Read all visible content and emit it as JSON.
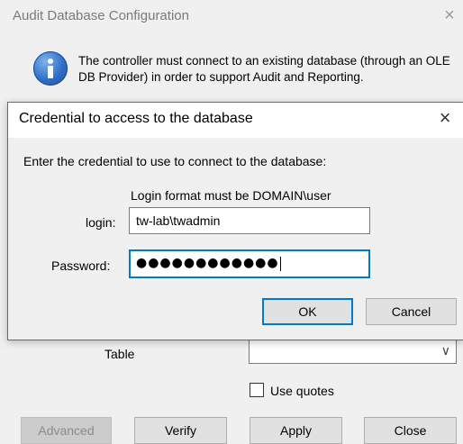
{
  "outer": {
    "title": "Audit Database Configuration",
    "close_glyph": "×",
    "info_icon": "info-icon",
    "info_text": "The controller must connect to an existing database (through an OLE DB Provider) in order to support Audit and Reporting.",
    "table_label": "Table",
    "table_value": "",
    "table_chevron": "∨",
    "use_quotes_label": "Use quotes",
    "use_quotes_checked": false,
    "buttons": {
      "advanced": "Advanced",
      "verify": "Verify",
      "apply": "Apply",
      "close": "Close"
    }
  },
  "dialog": {
    "title": "Credential to access to the database",
    "close_glyph": "×",
    "instruction": "Enter the credential to use to connect to the database:",
    "format_note": "Login format must be DOMAIN\\user",
    "login_label": "login:",
    "login_value": "tw-lab\\twadmin",
    "password_label": "Password:",
    "password_mask": "●●●●●●●●●●●●",
    "ok_label": "OK",
    "cancel_label": "Cancel"
  },
  "colors": {
    "accent": "#0078d7",
    "window_bg": "#f0f0f0",
    "disabled_text": "#8a8a8a"
  }
}
